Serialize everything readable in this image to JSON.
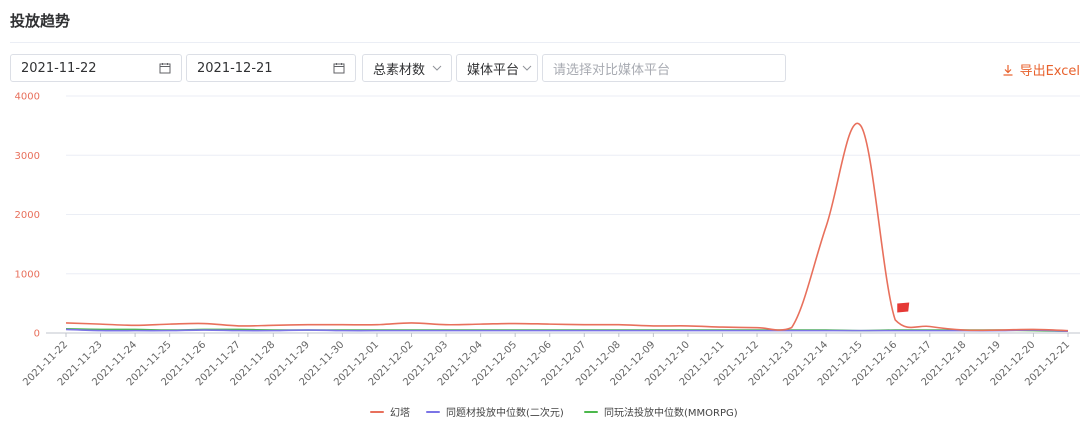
{
  "page": {
    "title": "投放趋势"
  },
  "toolbar": {
    "start_date": "2021-11-22",
    "end_date": "2021-12-21",
    "metric_select": "总素材数",
    "platform_select": "媒体平台",
    "compare_placeholder": "请选择对比媒体平台",
    "export_label": "导出Excel"
  },
  "icons": {
    "calendar": "calendar-icon",
    "chevron": "chevron-down-icon",
    "export": "download-icon"
  },
  "colors": {
    "accent": "#e8612c",
    "series_1": "#e8705c",
    "series_2": "#7b74e6",
    "series_3": "#4cb84c",
    "marker_flag": "#e53935"
  },
  "chart_data": {
    "type": "line",
    "x": [
      "2021-11-22",
      "2021-11-23",
      "2021-11-24",
      "2021-11-25",
      "2021-11-26",
      "2021-11-27",
      "2021-11-28",
      "2021-11-29",
      "2021-11-30",
      "2021-12-01",
      "2021-12-02",
      "2021-12-03",
      "2021-12-04",
      "2021-12-05",
      "2021-12-06",
      "2021-12-07",
      "2021-12-08",
      "2021-12-09",
      "2021-12-10",
      "2021-12-11",
      "2021-12-12",
      "2021-12-13",
      "2021-12-14",
      "2021-12-15",
      "2021-12-16",
      "2021-12-17",
      "2021-12-18",
      "2021-12-19",
      "2021-12-20",
      "2021-12-21"
    ],
    "ylim": [
      0,
      4000
    ],
    "yticks": [
      0,
      1000,
      2000,
      3000,
      4000
    ],
    "grid": true,
    "legend_position": "bottom",
    "series": [
      {
        "name": "幻塔",
        "values": [
          170,
          150,
          130,
          150,
          160,
          120,
          130,
          140,
          140,
          140,
          170,
          140,
          150,
          160,
          150,
          140,
          140,
          120,
          120,
          100,
          90,
          90,
          1800,
          3500,
          220,
          110,
          50,
          50,
          60,
          40
        ]
      },
      {
        "name": "同题材投放中位数(二次元)",
        "values": [
          60,
          40,
          40,
          40,
          50,
          40,
          40,
          50,
          40,
          40,
          40,
          40,
          40,
          40,
          40,
          40,
          40,
          40,
          40,
          40,
          40,
          40,
          40,
          40,
          40,
          40,
          40,
          40,
          50,
          30
        ]
      },
      {
        "name": "同玩法投放中位数(MMORPG)",
        "values": [
          70,
          60,
          60,
          50,
          60,
          60,
          50,
          50,
          50,
          50,
          50,
          50,
          50,
          50,
          50,
          50,
          50,
          50,
          50,
          50,
          50,
          50,
          50,
          40,
          50,
          50,
          50,
          50,
          40,
          30
        ]
      }
    ],
    "markers": [
      {
        "type": "flag",
        "x": "2021-12-16",
        "y": 430
      }
    ]
  }
}
